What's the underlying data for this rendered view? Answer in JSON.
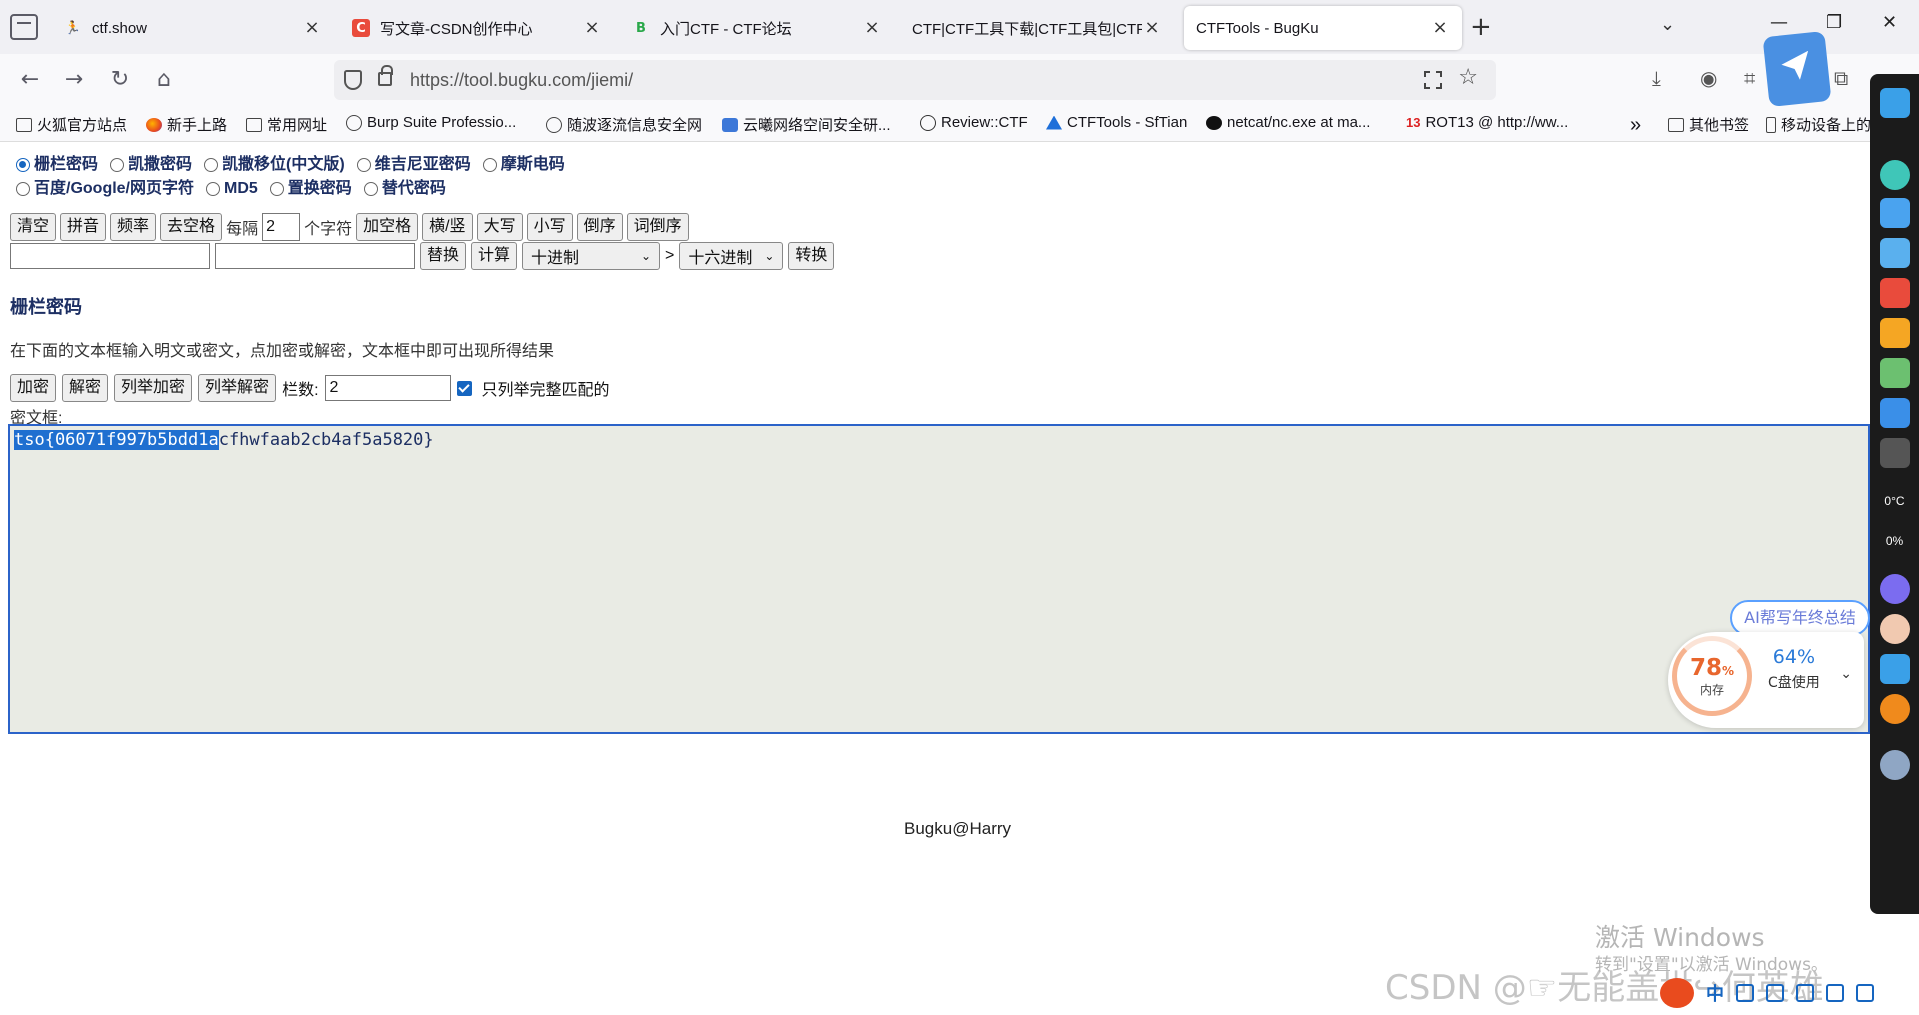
{
  "browser": {
    "tabs": [
      {
        "title": "ctf.show",
        "icon": "runner-icon"
      },
      {
        "title": "写文章-CSDN创作中心",
        "icon": "csdn-icon"
      },
      {
        "title": "入门CTF - CTF论坛",
        "icon": "forum-icon"
      },
      {
        "title": "CTF|CTF工具下载|CTF工具包|CTF教",
        "icon": ""
      },
      {
        "title": "CTFTools - BugKu",
        "icon": ""
      }
    ],
    "new_tab": "+",
    "url": "https://tool.bugku.com/jiemi/",
    "bookmarks": [
      {
        "label": "火狐官方站点",
        "icon": "folder-icon"
      },
      {
        "label": "新手上路",
        "icon": "firefox-icon"
      },
      {
        "label": "常用网址",
        "icon": "folder-icon"
      },
      {
        "label": "Burp Suite Professio...",
        "icon": "globe-icon"
      },
      {
        "label": "随波逐流信息安全网",
        "icon": "globe-icon"
      },
      {
        "label": "云曦网络空间安全研...",
        "icon": "cloud-icon"
      },
      {
        "label": "Review::CTF",
        "icon": "review-icon"
      },
      {
        "label": "CTFTools - SfTian",
        "icon": "ctftools-icon"
      },
      {
        "label": "netcat/nc.exe at ma...",
        "icon": "github-icon"
      },
      {
        "label": "ROT13 @ http://ww...",
        "icon": "rot13-icon"
      }
    ],
    "bookmarks_overflow": "»",
    "other_bookmarks": "其他书签",
    "mobile_bookmarks": "移动设备上的"
  },
  "page": {
    "cipher_options_row1": [
      {
        "label": "栅栏密码",
        "checked": true
      },
      {
        "label": "凯撒密码",
        "checked": false
      },
      {
        "label": "凯撒移位(中文版)",
        "checked": false
      },
      {
        "label": "维吉尼亚密码",
        "checked": false
      },
      {
        "label": "摩斯电码",
        "checked": false
      }
    ],
    "cipher_options_row2": [
      {
        "label": "百度/Google/网页字符",
        "checked": false
      },
      {
        "label": "MD5",
        "checked": false
      },
      {
        "label": "置换密码",
        "checked": false
      },
      {
        "label": "替代密码",
        "checked": false
      }
    ],
    "tool_buttons": [
      "清空",
      "拼音",
      "频率",
      "去空格"
    ],
    "every_label": "每隔",
    "every_value": "2",
    "chars_label": "个字符",
    "tool_buttons2": [
      "加空格",
      "横/竖",
      "大写",
      "小写",
      "倒序",
      "词倒序"
    ],
    "replace_button": "替换",
    "calc_button": "计算",
    "from_base": "十进制",
    "arrow": ">",
    "to_base": "十六进制",
    "convert_button": "转换",
    "section_title": "栅栏密码",
    "description": "在下面的文本框输入明文或密文，点加密或解密，文本框中即可出现所得结果",
    "encrypt_button": "加密",
    "decrypt_button": "解密",
    "enum_encrypt_button": "列举加密",
    "enum_decrypt_button": "列举解密",
    "columns_label": "栏数:",
    "columns_value": "2",
    "only_complete_label": "只列举完整匹配的",
    "only_complete_checked": true,
    "cipher_label": "密文框:",
    "cipher_selected": "tso{06071f997b5bdd1a",
    "cipher_rest": "cfhwfaab2cb4af5a5820}",
    "footer": "Bugku@Harry"
  },
  "widgets": {
    "ai_pill": "AI帮写年终总结",
    "memory_pct": "78",
    "memory_unit": "%",
    "memory_label": "内存",
    "disk_pct": "64%",
    "disk_label": "C盘使用",
    "dock_temp": "0°C",
    "dock_cpu": "0%"
  },
  "overlay": {
    "activate_title": "激活 Windows",
    "activate_sub": "转到\"设置\"以激活 Windows。",
    "watermark": "CSDN @☞无能盖世↪何英雄",
    "ime_label": "中"
  },
  "colors": {
    "accent": "#1565c0",
    "heading": "#1d2f63",
    "selection": "#1f6fd0",
    "cipher_bg": "#e9ebe4"
  }
}
